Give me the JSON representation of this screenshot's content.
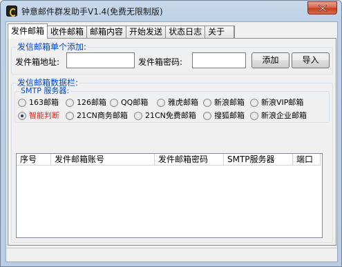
{
  "window": {
    "title": "钟意邮件群发助手V1.4(免费无限制版)",
    "icon": "app-logo-icon",
    "close_icon": "close-icon"
  },
  "tabs": [
    {
      "label": "发件邮箱",
      "active": true
    },
    {
      "label": "收件邮箱",
      "active": false
    },
    {
      "label": "邮箱内容",
      "active": false
    },
    {
      "label": "开始发送",
      "active": false
    },
    {
      "label": "状态日志",
      "active": false
    },
    {
      "label": "关于",
      "active": false
    }
  ],
  "single_add": {
    "legend": "发信邮箱单个添加:",
    "address_label": "发件箱地址:",
    "address_value": "",
    "password_label": "发件箱密码:",
    "password_value": "",
    "add_button": "添加",
    "import_button": "导入"
  },
  "data_section": {
    "legend": "发信邮箱数据栏:",
    "smtp_legend": "SMTP 服务器:",
    "options_row1": [
      "163邮箱",
      "126邮箱",
      "QQ邮箱",
      "雅虎邮箱",
      "新浪邮箱",
      "新浪VIP邮箱"
    ],
    "options_row2": [
      "智能判断",
      "21CN商务邮箱",
      "21CN免费邮箱",
      "搜狐邮箱",
      "新浪企业邮箱"
    ],
    "selected_option": "智能判断",
    "highlight_color": "#e8231a"
  },
  "table": {
    "columns": [
      "序号",
      "发件邮箱账号",
      "发件邮箱密码",
      "SMTP服务器",
      "端口"
    ],
    "rows": []
  },
  "colors": {
    "legend_text": "#0046d5",
    "title_bar": "#bdd0e6",
    "close_button": "#c5401f"
  }
}
